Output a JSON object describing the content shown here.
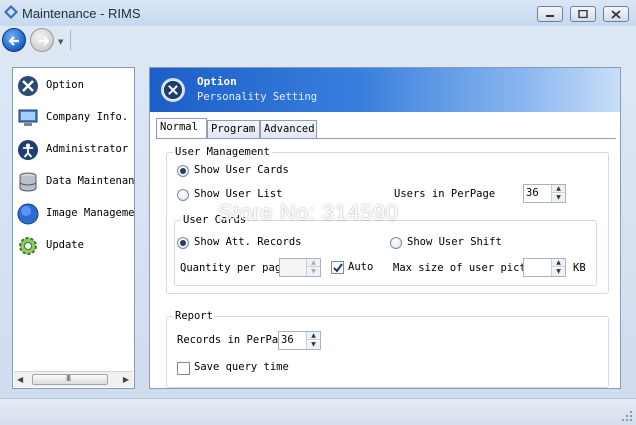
{
  "window": {
    "title": "Maintenance - RIMS"
  },
  "sidebar": {
    "items": [
      {
        "label": "Option",
        "icon": "wrench-cross-icon"
      },
      {
        "label": "Company Info.",
        "icon": "computer-icon"
      },
      {
        "label": "Administrator",
        "icon": "person-icon"
      },
      {
        "label": "Data Maintenance",
        "icon": "database-icon"
      },
      {
        "label": "Image Management",
        "icon": "globe-icon"
      },
      {
        "label": "Update",
        "icon": "update-gear-icon"
      }
    ],
    "scroll_grip": "III"
  },
  "banner": {
    "title": "Option",
    "subtitle": "Personality Setting"
  },
  "tabs": [
    {
      "label": "Normal"
    },
    {
      "label": "Program"
    },
    {
      "label": "Advanced"
    }
  ],
  "user_management": {
    "title": "User Management",
    "show_user_cards": "Show User Cards",
    "show_user_list": "Show User List",
    "users_in_perpage_label": "Users in PerPage",
    "users_in_perpage_value": "36",
    "selected": "show_user_cards"
  },
  "user_cards": {
    "title": "User Cards",
    "show_att_records": "Show Att. Records",
    "show_user_shift": "Show User Shift",
    "selected": "show_att_records",
    "quantity_label": "Quantity per page",
    "quantity_value": "",
    "auto_label": "Auto",
    "auto_checked": true,
    "max_size_label": "Max size of user picture",
    "max_size_value": "",
    "max_size_unit": "KB"
  },
  "report": {
    "title": "Report",
    "records_label": "Records in PerPag",
    "records_value": "36",
    "save_query_label": "Save query time",
    "save_query_checked": false
  },
  "watermark": "Store No: 314590"
}
